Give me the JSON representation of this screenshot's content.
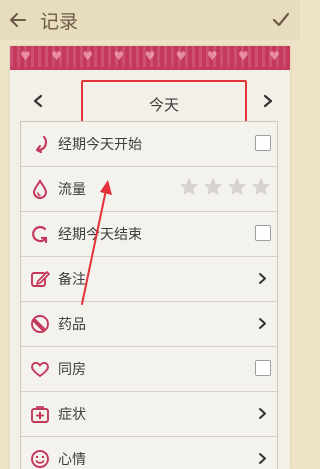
{
  "header": {
    "title": "记录"
  },
  "date": {
    "label": "今天"
  },
  "rows": [
    {
      "label": "经期今天开始",
      "control": "checkbox"
    },
    {
      "label": "流量",
      "control": "stars",
      "rating": 0,
      "max_rating": 4
    },
    {
      "label": "经期今天结束",
      "control": "checkbox"
    },
    {
      "label": "备注",
      "control": "chevron"
    },
    {
      "label": "药品",
      "control": "chevron"
    },
    {
      "label": "同房",
      "control": "checkbox"
    },
    {
      "label": "症状",
      "control": "chevron"
    },
    {
      "label": "心情",
      "control": "chevron"
    }
  ],
  "icons": {
    "back": "arrow-left-icon",
    "confirm": "check-icon",
    "prev": "chevron-left-icon",
    "next": "chevron-right-icon"
  },
  "colors": {
    "accent": "#c4385e",
    "annotation": "#e3313a",
    "star_empty": "#d7d4cf"
  }
}
